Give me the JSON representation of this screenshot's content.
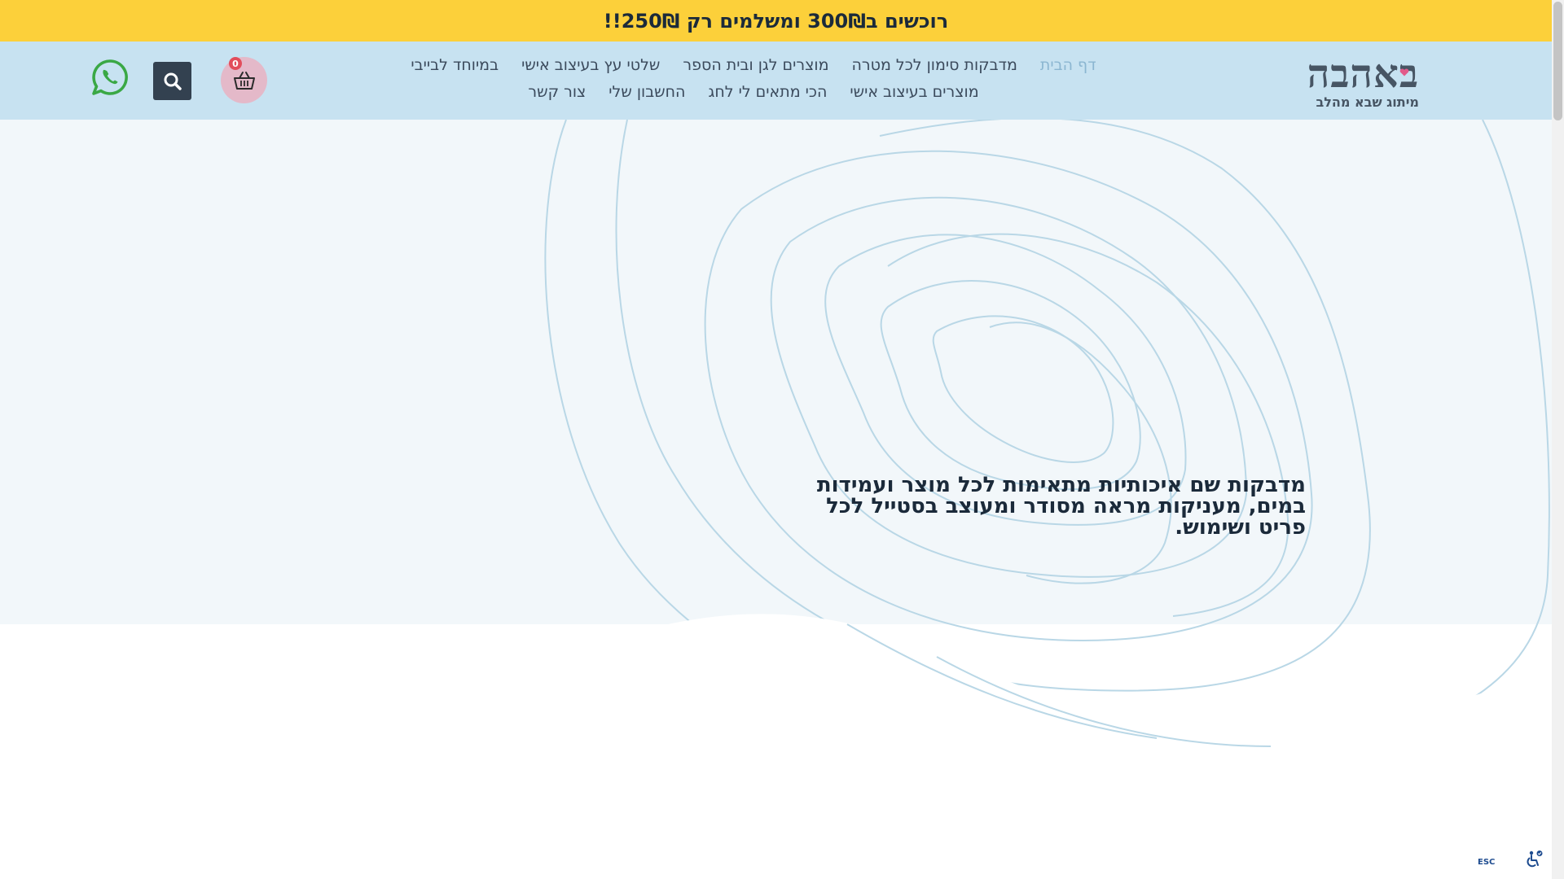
{
  "announcement": {
    "text": "רוכשים ב300₪ ומשלמים רק 250₪!!"
  },
  "brand": {
    "logo_main": "באהבה",
    "logo_sub": "מיתוג שבא מהלב"
  },
  "nav": {
    "row1": [
      {
        "label": "דף הבית",
        "active": true
      },
      {
        "label": "מדבקות סימון לכל מטרה"
      },
      {
        "label": "מוצרים לגן ובית הספר"
      },
      {
        "label": "שלטי עץ בעיצוב אישי"
      },
      {
        "label": "במיוחד לבייבי"
      }
    ],
    "row2": [
      {
        "label": "מוצרים בעיצוב אישי"
      },
      {
        "label": "הכי מתאים לי לחג"
      },
      {
        "label": "החשבון שלי"
      },
      {
        "label": "צור קשר"
      }
    ]
  },
  "cart": {
    "count": "0",
    "icon": "basket-icon"
  },
  "search": {
    "icon": "search-icon"
  },
  "whatsapp": {
    "icon": "whatsapp-icon"
  },
  "hero": {
    "text": "מדבקות שם איכותיות מתאימות לכל מוצר ועמידות במים, מעניקות מראה מסודר ומעוצב בסטייל לכל פריט ושימוש."
  },
  "accessibility": {
    "esc_label": "ESC",
    "icon": "accessibility-icon"
  },
  "colors": {
    "announcement_bg": "#fcd03a",
    "header_bg": "#c7e2f1",
    "active_nav": "#8bb6d1",
    "cart_bg": "#e4b9c9",
    "whatsapp_green": "#3aa845"
  }
}
